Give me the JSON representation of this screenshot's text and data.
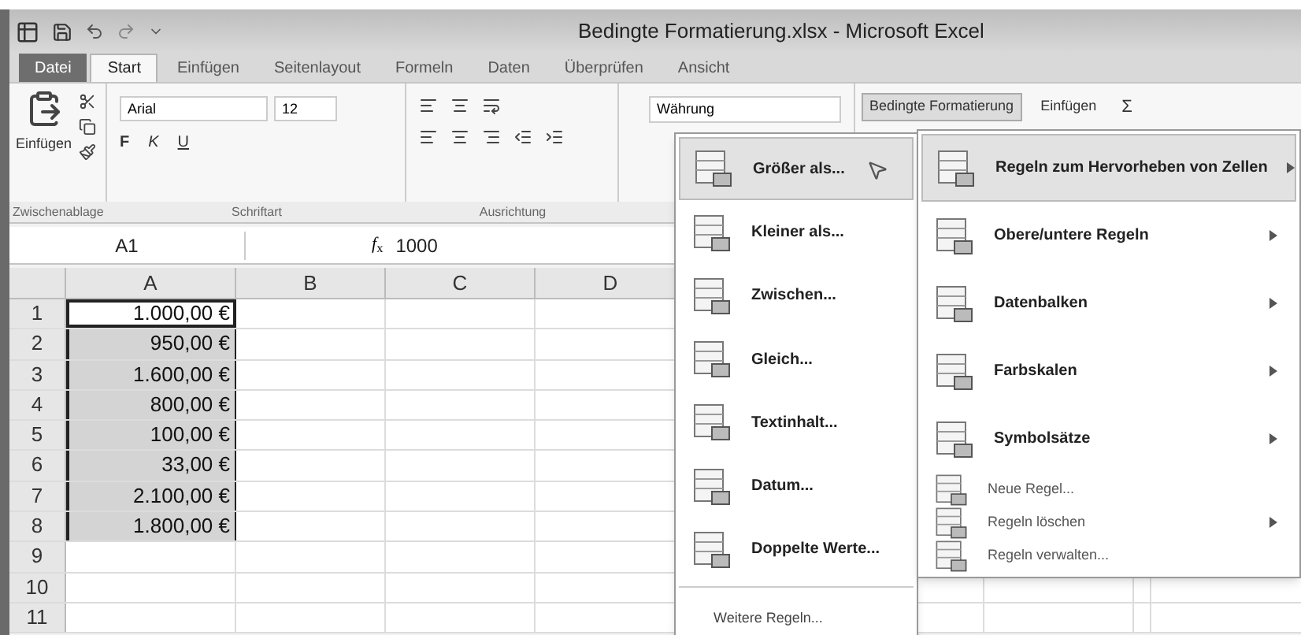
{
  "window": {
    "title": "Bedingte Formatierung.xlsx - Microsoft Excel"
  },
  "tabs": [
    {
      "label": "Datei",
      "kind": "file",
      "selected": false
    },
    {
      "label": "Start",
      "kind": "tab",
      "selected": true
    },
    {
      "label": "Einfügen",
      "kind": "tab",
      "selected": false
    },
    {
      "label": "Seitenlayout",
      "kind": "tab",
      "selected": false
    },
    {
      "label": "Formeln",
      "kind": "tab",
      "selected": false
    },
    {
      "label": "Daten",
      "kind": "tab",
      "selected": false
    },
    {
      "label": "Überprüfen",
      "kind": "tab",
      "selected": false
    },
    {
      "label": "Ansicht",
      "kind": "tab",
      "selected": false
    }
  ],
  "ribbon": {
    "clipboard": {
      "paste_label": "Einfügen",
      "group_label": "Zwischenablage"
    },
    "font": {
      "name": "Arial",
      "size": "12",
      "bold": "F",
      "italic": "K",
      "underline": "U",
      "group_label": "Schriftart"
    },
    "alignment": {
      "group_label": "Ausrichtung"
    },
    "number": {
      "format": "Währung"
    },
    "styles": {
      "conditional_button": "Bedingte Formatierung",
      "expanded": true
    },
    "cells": {
      "insert_button": "Einfügen"
    },
    "editing": {
      "sum": "Σ"
    }
  },
  "formula_bar": {
    "name_box": "A1",
    "fx": "*f*$_{x}$",
    "formula": "1000"
  },
  "columns": [
    "A",
    "B",
    "C",
    "D"
  ],
  "rows": [
    {
      "header": "1",
      "value": "1.000,00 €",
      "selected": true,
      "active": true
    },
    {
      "header": "2",
      "value": "950,00 €",
      "selected": true,
      "active": false
    },
    {
      "header": "3",
      "value": "1.600,00 €",
      "selected": true,
      "active": false
    },
    {
      "header": "4",
      "value": "800,00 €",
      "selected": true,
      "active": false
    },
    {
      "header": "5",
      "value": "100,00 €",
      "selected": true,
      "active": false
    },
    {
      "header": "6",
      "value": "33,00 €",
      "selected": true,
      "active": false
    },
    {
      "header": "7",
      "value": "2.100,00 €",
      "selected": true,
      "active": false
    },
    {
      "header": "8",
      "value": "1.800,00 €",
      "selected": true,
      "active": false
    },
    {
      "header": "9",
      "selected": false,
      "active": false
    },
    {
      "header": "10",
      "selected": false,
      "active": false
    },
    {
      "header": "11",
      "selected": false,
      "active": false
    }
  ],
  "menu": {
    "items": [
      {
        "label": "Regeln zum Hervorheben von Zellen",
        "kind": "large",
        "selected": true,
        "has_submenu": true
      },
      {
        "label": "Obere/untere Regeln",
        "kind": "large",
        "selected": false,
        "has_submenu": true
      },
      {
        "label": "Datenbalken",
        "kind": "large",
        "selected": false,
        "has_submenu": true
      },
      {
        "label": "Farbskalen",
        "kind": "large",
        "selected": false,
        "has_submenu": true
      },
      {
        "label": "Symbolsätze",
        "kind": "large",
        "selected": false,
        "has_submenu": true
      },
      {
        "label": "Neue Regel...",
        "kind": "small",
        "selected": false,
        "has_submenu": false
      },
      {
        "label": "Regeln löschen",
        "kind": "small",
        "selected": false,
        "has_submenu": true
      },
      {
        "label": "Regeln verwalten...",
        "kind": "small",
        "selected": false,
        "has_submenu": false
      }
    ]
  },
  "submenu": {
    "items": [
      {
        "label": "Größer als...",
        "selected": true
      },
      {
        "label": "Kleiner als...",
        "selected": false
      },
      {
        "label": "Zwischen...",
        "selected": false
      },
      {
        "label": "Gleich...",
        "selected": false
      },
      {
        "label": "Textinhalt...",
        "selected": false
      },
      {
        "label": "Datum...",
        "selected": false
      },
      {
        "label": "Doppelte Werte...",
        "selected": false
      }
    ],
    "footer": "Weitere Regeln..."
  }
}
